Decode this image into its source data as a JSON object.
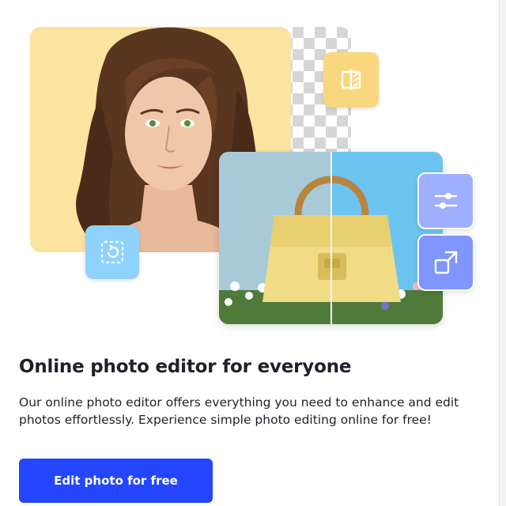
{
  "hero": {
    "tiles": [
      {
        "icon": "compare-icon",
        "color": "#f9d77f"
      },
      {
        "icon": "rotate-icon",
        "color": "#8fd2ff"
      },
      {
        "icon": "adjust-sliders-icon",
        "color": "#9eb0ff"
      },
      {
        "icon": "resize-icon",
        "color": "#7f96ff"
      }
    ],
    "portrait_bg_color": "#fbe3a0",
    "bag_color": "#f2dc86"
  },
  "content": {
    "headline": "Online photo editor for everyone",
    "description": "Our online photo editor offers everything you need to enhance and edit photos effortlessly. Experience simple photo editing online for free!"
  },
  "cta": {
    "label": "Edit photo for free",
    "color": "#2446ff"
  }
}
